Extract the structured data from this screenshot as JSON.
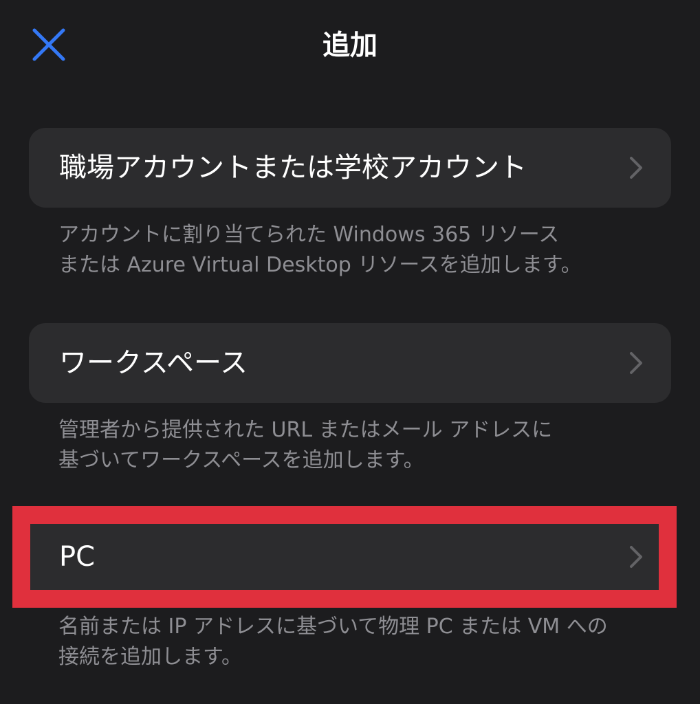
{
  "header": {
    "title": "追加",
    "close_icon": "close-icon",
    "accent_color": "#3478f6"
  },
  "options": [
    {
      "label": "職場アカウントまたは学校アカウント",
      "description": [
        "アカウントに割り当てられた Windows 365 リソース",
        "または Azure Virtual Desktop リソースを追加します。"
      ]
    },
    {
      "label": "ワークスペース",
      "description": [
        "管理者から提供された URL またはメール アドレスに",
        "基づいてワークスペースを追加します。"
      ]
    },
    {
      "label": "PC",
      "description": [
        "名前または IP アドレスに基づいて物理 PC または VM への",
        "接続を追加します。"
      ],
      "highlighted": true
    }
  ],
  "highlight_color": "#e0303d"
}
